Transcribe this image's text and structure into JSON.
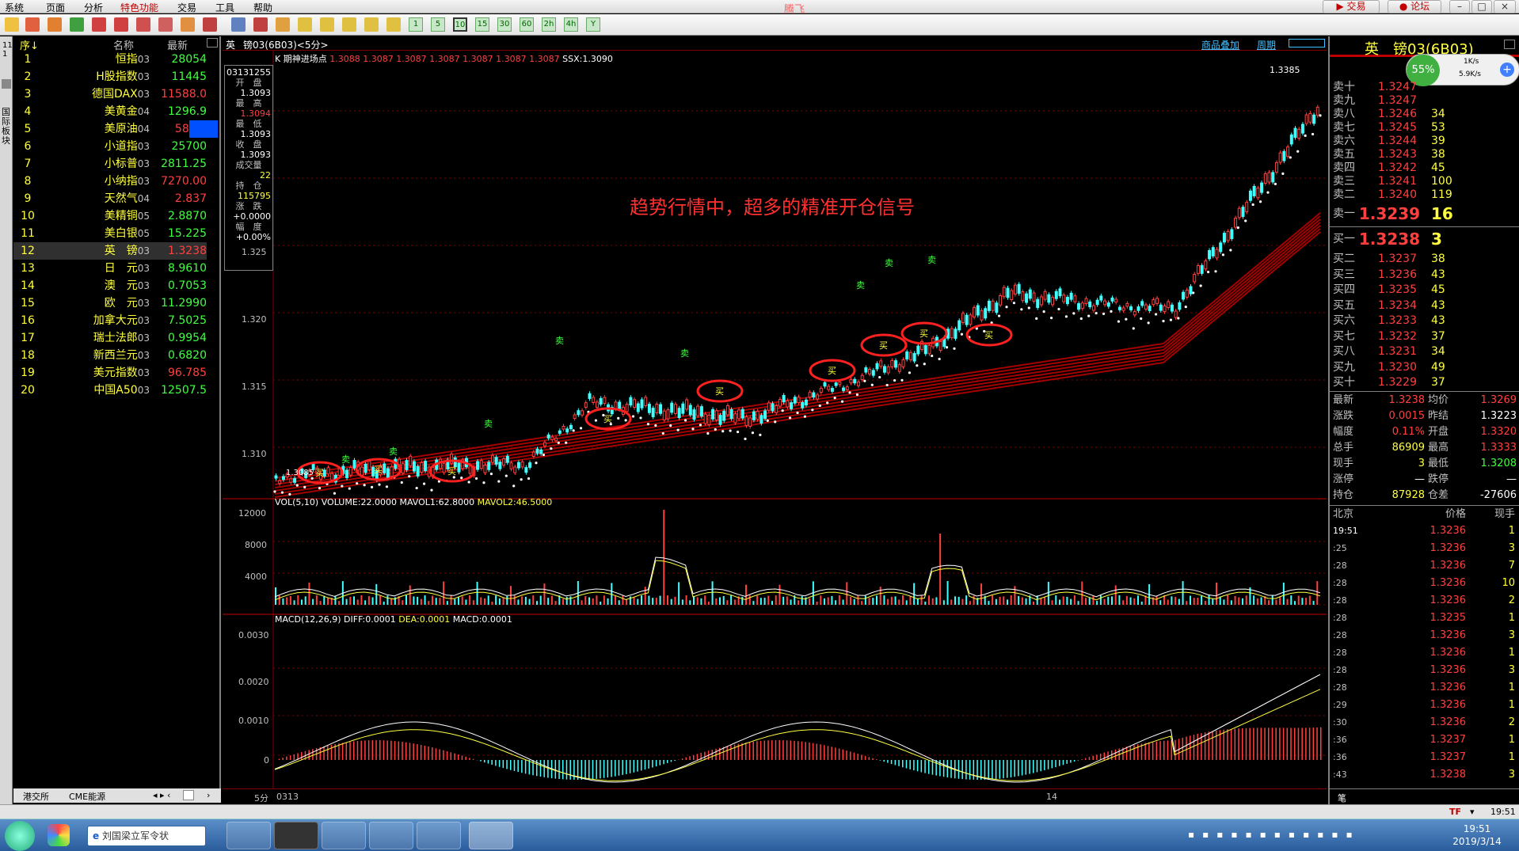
{
  "menu": {
    "items": [
      "系统",
      "页面",
      "分析",
      "特色功能",
      "交易",
      "工具",
      "帮助"
    ],
    "app_title": "腾飞",
    "trade_label": "交易",
    "forum_label": "论坛"
  },
  "toolbar": {
    "period_buttons": [
      "1",
      "5",
      "10",
      "15",
      "30",
      "60",
      "2h",
      "4h",
      "Y"
    ]
  },
  "left_tabs": {
    "label": "国际板块",
    "page_nums": "11 1"
  },
  "quote_list": {
    "headers": {
      "index": "序↓",
      "name": "名称",
      "latest": "最新"
    },
    "rows": [
      {
        "n": "1",
        "name": "恒指",
        "code": "03",
        "v": "28054",
        "color": "#40ff40"
      },
      {
        "n": "2",
        "name": "H股指数",
        "code": "03",
        "v": "11445",
        "color": "#40ff40"
      },
      {
        "n": "3",
        "name": "德国DAX",
        "code": "03",
        "v": "11588.0",
        "color": "#ff4040"
      },
      {
        "n": "4",
        "name": "美黄金",
        "code": "04",
        "v": "1296.9",
        "color": "#40ff40"
      },
      {
        "n": "5",
        "name": "美原油",
        "code": "04",
        "v": "58.16",
        "color": "#ff4040"
      },
      {
        "n": "6",
        "name": "小道指",
        "code": "03",
        "v": "25700",
        "color": "#40ff40"
      },
      {
        "n": "7",
        "name": "小标普",
        "code": "03",
        "v": "2811.25",
        "color": "#40ff40"
      },
      {
        "n": "8",
        "name": "小纳指",
        "code": "03",
        "v": "7270.00",
        "color": "#ff4040"
      },
      {
        "n": "9",
        "name": "天然气",
        "code": "04",
        "v": "2.837",
        "color": "#ff4040"
      },
      {
        "n": "10",
        "name": "美精铜",
        "code": "05",
        "v": "2.8870",
        "color": "#40ff40"
      },
      {
        "n": "11",
        "name": "美白银",
        "code": "05",
        "v": "15.225",
        "color": "#40ff40"
      },
      {
        "n": "12",
        "name": "英　镑",
        "code": "03",
        "v": "1.3238",
        "color": "#ff4040"
      },
      {
        "n": "13",
        "name": "日　元",
        "code": "03",
        "v": "8.9610",
        "color": "#40ff40"
      },
      {
        "n": "14",
        "name": "澳　元",
        "code": "03",
        "v": "0.7053",
        "color": "#40ff40"
      },
      {
        "n": "15",
        "name": "欧　元",
        "code": "03",
        "v": "11.2990",
        "color": "#40ff40"
      },
      {
        "n": "16",
        "name": "加拿大元",
        "code": "03",
        "v": "7.5025",
        "color": "#40ff40"
      },
      {
        "n": "17",
        "name": "瑞士法郎",
        "code": "03",
        "v": "0.9954",
        "color": "#40ff40"
      },
      {
        "n": "18",
        "name": "新西兰元",
        "code": "03",
        "v": "0.6820",
        "color": "#40ff40"
      },
      {
        "n": "19",
        "name": "美元指数",
        "code": "03",
        "v": "96.785",
        "color": "#ff4040"
      },
      {
        "n": "20",
        "name": "中国A50",
        "code": "03",
        "v": "12507.5",
        "color": "#40ff40"
      }
    ],
    "footer_tabs": [
      "港交所",
      "CME能源"
    ]
  },
  "chart": {
    "header_left": "英",
    "header_name": "镑03(6B03)<5分>",
    "header_right1": "商品叠加",
    "header_right2": "周期",
    "kline_label": "K  期神进场点",
    "kline_values": "1.3088 1.3087 1.3087 1.3087 1.3087 1.3087 1.3087",
    "ssx": "SSX:1.3090",
    "annotation": "趋势行情中，超多的精准开仓信号",
    "buy_label": "买",
    "sell_label": "卖",
    "high_marker": "1.3385",
    "low_marker": "1.3085",
    "info_box": {
      "date": "03131255",
      "open_label": "开　盘",
      "open": "1.3093",
      "high_label": "最　高",
      "high": "1.3094",
      "low_label": "最　低",
      "low": "1.3093",
      "close_label": "收　盘",
      "close": "1.3093",
      "vol_label": "成交量",
      "vol": "22",
      "oi_label": "持　仓",
      "oi": "115795",
      "chg_label": "涨　跌",
      "chg": "+0.0000",
      "pct_label": "幅　度",
      "pct": "+0.00%"
    },
    "price_ticks": [
      "1.325",
      "1.320",
      "1.315",
      "1.310"
    ],
    "vol_label": "VOL(5,10)",
    "vol_volume": "VOLUME:22.0000",
    "vol_mavol1": "MAVOL1:62.8000",
    "vol_mavol2": "MAVOL2:46.5000",
    "vol_ticks": [
      "12000",
      "8000",
      "4000"
    ],
    "macd_label": "MACD(12,26,9)",
    "macd_diff": "DIFF:0.0001",
    "macd_dea": "DEA:0.0001",
    "macd_macd": "MACD:0.0001",
    "macd_ticks": [
      "0.0030",
      "0.0020",
      "0.0010",
      "0"
    ],
    "period": "5分",
    "x_start": "0313",
    "x_mid": "14"
  },
  "right_panel": {
    "title": "英　镑03(6B03)",
    "badge_pct": "55%",
    "speed_up": "1K/s",
    "speed_down": "5.9K/s",
    "sells": [
      {
        "l": "卖十",
        "p": "1.3247",
        "q": ""
      },
      {
        "l": "卖九",
        "p": "1.3247",
        "q": ""
      },
      {
        "l": "卖八",
        "p": "1.3246",
        "q": "34"
      },
      {
        "l": "卖七",
        "p": "1.3245",
        "q": "53"
      },
      {
        "l": "卖六",
        "p": "1.3244",
        "q": "39"
      },
      {
        "l": "卖五",
        "p": "1.3243",
        "q": "38"
      },
      {
        "l": "卖四",
        "p": "1.3242",
        "q": "45"
      },
      {
        "l": "卖三",
        "p": "1.3241",
        "q": "100"
      },
      {
        "l": "卖二",
        "p": "1.3240",
        "q": "119"
      }
    ],
    "sell1": {
      "l": "卖一",
      "p": "1.3239",
      "q": "16"
    },
    "buy1": {
      "l": "买一",
      "p": "1.3238",
      "q": "3"
    },
    "buys": [
      {
        "l": "买二",
        "p": "1.3237",
        "q": "38"
      },
      {
        "l": "买三",
        "p": "1.3236",
        "q": "43"
      },
      {
        "l": "买四",
        "p": "1.3235",
        "q": "45"
      },
      {
        "l": "买五",
        "p": "1.3234",
        "q": "43"
      },
      {
        "l": "买六",
        "p": "1.3233",
        "q": "43"
      },
      {
        "l": "买七",
        "p": "1.3232",
        "q": "37"
      },
      {
        "l": "买八",
        "p": "1.3231",
        "q": "34"
      },
      {
        "l": "买九",
        "p": "1.3230",
        "q": "49"
      },
      {
        "l": "买十",
        "p": "1.3229",
        "q": "37"
      }
    ],
    "stats": [
      {
        "a": "最新",
        "b": "1.3238",
        "bc": "#ff4040",
        "c": "均价",
        "d": "1.3269",
        "dc": "#ff4040"
      },
      {
        "a": "涨跌",
        "b": "0.0015",
        "bc": "#ff4040",
        "c": "昨结",
        "d": "1.3223",
        "dc": "#ffffff"
      },
      {
        "a": "幅度",
        "b": "0.11%",
        "bc": "#ff4040",
        "c": "开盘",
        "d": "1.3320",
        "dc": "#ff4040"
      },
      {
        "a": "总手",
        "b": "86909",
        "bc": "#ffff40",
        "c": "最高",
        "d": "1.3333",
        "dc": "#ff4040"
      },
      {
        "a": "现手",
        "b": "3",
        "bc": "#ffff40",
        "c": "最低",
        "d": "1.3208",
        "dc": "#40ff40"
      },
      {
        "a": "涨停",
        "b": "—",
        "bc": "#ffffff",
        "c": "跌停",
        "d": "—",
        "dc": "#ffffff"
      },
      {
        "a": "持仓",
        "b": "87928",
        "bc": "#ffff40",
        "c": "仓差",
        "d": "-27606",
        "dc": "#ffffff"
      }
    ],
    "tick_header": {
      "t": "北京",
      "p": "价格",
      "q": "现手"
    },
    "ticks": [
      {
        "t": "19:51",
        "p": "1.3236",
        "q": "1"
      },
      {
        "t": ":25",
        "p": "1.3236",
        "q": "3"
      },
      {
        "t": ":28",
        "p": "1.3236",
        "q": "7"
      },
      {
        "t": ":28",
        "p": "1.3236",
        "q": "10"
      },
      {
        "t": ":28",
        "p": "1.3236",
        "q": "2"
      },
      {
        "t": ":28",
        "p": "1.3235",
        "q": "1"
      },
      {
        "t": ":28",
        "p": "1.3236",
        "q": "3"
      },
      {
        "t": ":28",
        "p": "1.3236",
        "q": "1"
      },
      {
        "t": ":28",
        "p": "1.3236",
        "q": "3"
      },
      {
        "t": ":28",
        "p": "1.3236",
        "q": "1"
      },
      {
        "t": ":29",
        "p": "1.3236",
        "q": "1"
      },
      {
        "t": ":30",
        "p": "1.3236",
        "q": "2"
      },
      {
        "t": ":36",
        "p": "1.3237",
        "q": "1"
      },
      {
        "t": ":36",
        "p": "1.3237",
        "q": "1"
      },
      {
        "t": ":43",
        "p": "1.3238",
        "q": "3"
      }
    ],
    "bottom_tab": "笔"
  },
  "status": {
    "time": "19:51",
    "tf": "TF"
  },
  "taskbar": {
    "ie_text": "刘国梁立军令状",
    "clock_time": "19:51",
    "clock_date": "2019/3/14"
  },
  "colors": {
    "up": "#ff4040",
    "down": "#40ff40",
    "accent": "#ffff40",
    "cyan": "#40ffff"
  }
}
